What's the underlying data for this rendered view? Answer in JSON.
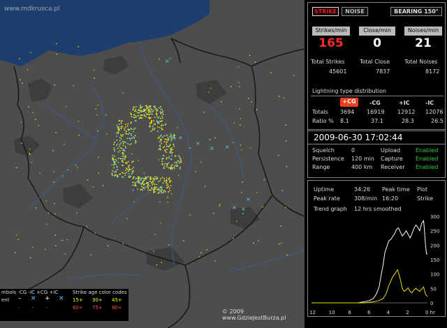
{
  "map": {
    "watermark": "www.mdkrusca.pl",
    "copyright": "© 2009 www.GdzieJestBurza.pl",
    "legend": {
      "header": "mbols -CG -IC +CG +IC",
      "strike_age_title": "Strike age color codes",
      "recent_label": "ent",
      "age_row1": [
        "15+",
        "30+",
        "45+"
      ],
      "age_row2": [
        "60+",
        "75+",
        "90+"
      ]
    }
  },
  "top_buttons": {
    "strike": "STRIKE",
    "noise": "NOISE",
    "bearing": "BEARING 150°"
  },
  "rates": {
    "strikes_label": "Strikes/min",
    "strikes_value": "165",
    "close_label": "Close/min",
    "close_value": "0",
    "noises_label": "Noises/min",
    "noises_value": "21"
  },
  "totals": {
    "strikes_label": "Total Strikes",
    "strikes_value": "45601",
    "close_label": "Total Close",
    "close_value": "7837",
    "noises_label": "Total Noises",
    "noises_value": "8172"
  },
  "distribution": {
    "title": "Lightning type distribution",
    "headers": [
      "+CG",
      "-CG",
      "+IC",
      "-IC"
    ],
    "totals_label": "Totals",
    "totals": [
      "3694",
      "16919",
      "12912",
      "12076"
    ],
    "ratio_label": "Ratio %",
    "ratios": [
      "8.1",
      "37.1",
      "28.3",
      "26.5"
    ]
  },
  "status": {
    "datetime": "2009-06-30 17:02:44",
    "squelch_label": "Squelch",
    "squelch_value": "0",
    "persistence_label": "Persistence",
    "persistence_value": "120 min",
    "range_label": "Range",
    "range_value": "400 km",
    "upload_label": "Upload",
    "upload_value": "Enabled",
    "capture_label": "Capture",
    "capture_value": "Enabled",
    "receiver_label": "Receiver",
    "receiver_value": "Enabled"
  },
  "stats": {
    "uptime_label": "Uptime",
    "uptime_value": "34:26",
    "peak_time_label": "Peak time",
    "peak_time_value": "16:20",
    "plot_label": "Plot",
    "plot_value": "Strike",
    "peak_rate_label": "Peak rate",
    "peak_rate_value": "308/min",
    "trend_label": "Trend graph",
    "trend_value": "12 hrs smoothed"
  },
  "chart_data": {
    "type": "line",
    "x": [
      12,
      10,
      8,
      6,
      4,
      2,
      0
    ],
    "x_tick_labels": [
      "12",
      "10",
      "8",
      "6",
      "4",
      "2",
      "0 hr"
    ],
    "y_tick_labels": [
      "0",
      "50",
      "100",
      "150",
      "200",
      "250",
      "300"
    ],
    "ylim": [
      0,
      300
    ],
    "xlim": [
      12,
      0
    ],
    "series": [
      {
        "color": "#ffffff",
        "points": [
          [
            12,
            0
          ],
          [
            9,
            0
          ],
          [
            7.2,
            0
          ],
          [
            6.5,
            4
          ],
          [
            6,
            8
          ],
          [
            5.6,
            15
          ],
          [
            5.3,
            30
          ],
          [
            5.0,
            55
          ],
          [
            4.8,
            95
          ],
          [
            4.6,
            130
          ],
          [
            4.4,
            175
          ],
          [
            4.2,
            195
          ],
          [
            4.0,
            215
          ],
          [
            3.8,
            220
          ],
          [
            3.6,
            230
          ],
          [
            3.4,
            240
          ],
          [
            3.2,
            255
          ],
          [
            3.0,
            260
          ],
          [
            2.8,
            245
          ],
          [
            2.6,
            232
          ],
          [
            2.4,
            240
          ],
          [
            2.2,
            250
          ],
          [
            2.0,
            238
          ],
          [
            1.8,
            225
          ],
          [
            1.6,
            240
          ],
          [
            1.4,
            258
          ],
          [
            1.2,
            270
          ],
          [
            1.0,
            262
          ],
          [
            0.8,
            250
          ],
          [
            0.6,
            275
          ],
          [
            0.4,
            285
          ],
          [
            0.3,
            250
          ],
          [
            0.2,
            200
          ],
          [
            0.1,
            170
          ],
          [
            0.0,
            170
          ]
        ]
      },
      {
        "color": "#f0e000",
        "points": [
          [
            12,
            0
          ],
          [
            6.5,
            0
          ],
          [
            5.5,
            4
          ],
          [
            5.0,
            8
          ],
          [
            4.6,
            15
          ],
          [
            4.3,
            30
          ],
          [
            4.0,
            60
          ],
          [
            3.8,
            75
          ],
          [
            3.6,
            90
          ],
          [
            3.4,
            100
          ],
          [
            3.2,
            110
          ],
          [
            3.1,
            115
          ],
          [
            3.0,
            105
          ],
          [
            2.8,
            80
          ],
          [
            2.6,
            50
          ],
          [
            2.4,
            40
          ],
          [
            2.2,
            45
          ],
          [
            2.0,
            52
          ],
          [
            1.8,
            40
          ],
          [
            1.6,
            35
          ],
          [
            1.4,
            45
          ],
          [
            1.2,
            50
          ],
          [
            1.0,
            45
          ],
          [
            0.8,
            40
          ],
          [
            0.6,
            48
          ],
          [
            0.4,
            55
          ],
          [
            0.2,
            30
          ],
          [
            0.0,
            22
          ]
        ]
      }
    ]
  }
}
